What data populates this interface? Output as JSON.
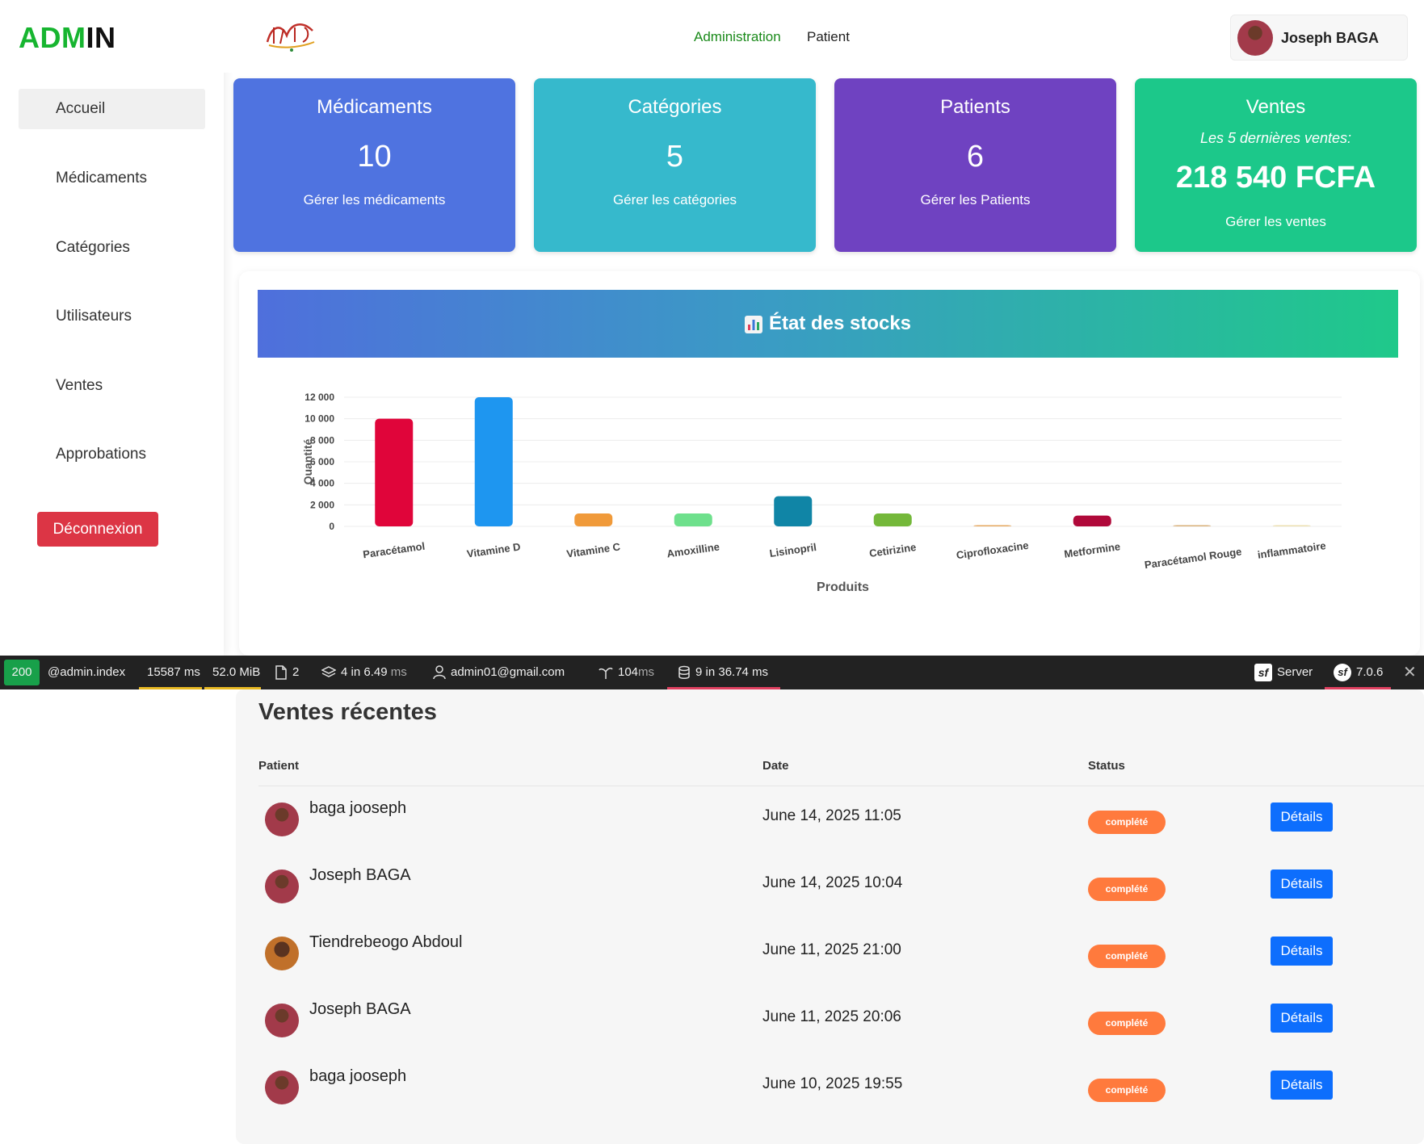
{
  "sidebar": {
    "brand_prefix": "ADM",
    "brand_suffix": "IN",
    "items": [
      {
        "label": "Accueil",
        "active": true
      },
      {
        "label": "Médicaments"
      },
      {
        "label": "Catégories"
      },
      {
        "label": "Utilisateurs"
      },
      {
        "label": "Ventes"
      },
      {
        "label": "Approbations"
      }
    ],
    "logout_label": "Déconnexion"
  },
  "header": {
    "nav": [
      {
        "label": "Administration",
        "active": true
      },
      {
        "label": "Patient"
      }
    ],
    "user_name": "Joseph BAGA"
  },
  "cards": [
    {
      "title": "Médicaments",
      "value": "10",
      "link": "Gérer les médicaments",
      "color": "#4f73e0"
    },
    {
      "title": "Catégories",
      "value": "5",
      "link": "Gérer les catégories",
      "color": "#36b9cc"
    },
    {
      "title": "Patients",
      "value": "6",
      "link": "Gérer les Patients",
      "color": "#6f42c1"
    },
    {
      "title": "Ventes",
      "subtitle": "Les 5 dernières ventes:",
      "value": "218 540 FCFA",
      "link": "Gérer les ventes",
      "color": "#1cc88a"
    }
  ],
  "chart_title": "État des stocks",
  "chart_data": {
    "type": "bar",
    "title": "État des stocks",
    "xlabel": "Produits",
    "ylabel": "Quantité",
    "ylim": [
      0,
      12000
    ],
    "yticks": [
      "0",
      "2 000",
      "4 000",
      "6 000",
      "8 000",
      "10 000",
      "12 000"
    ],
    "grid": true,
    "categories": [
      "Paracétamol",
      "Vitamine D",
      "Vitamine C",
      "Amoxilline",
      "Lisinopril",
      "Cetirizine",
      "Ciprofloxacine",
      "Metformine",
      "Paracétamol Rouge",
      "inflammatoire"
    ],
    "values": [
      10000,
      12000,
      1200,
      1200,
      2800,
      1200,
      0,
      1000,
      0,
      0
    ],
    "colors": [
      "#e0053a",
      "#1e96f0",
      "#f09a3a",
      "#6ee08c",
      "#1085a6",
      "#74b83a",
      "#e6a860",
      "#b0093a",
      "#d9b07a",
      "#ece0b0"
    ]
  },
  "toolbar": {
    "status": "200",
    "route": "@admin.index",
    "time": "15587 ms",
    "memory": "52.0 MiB",
    "files": "2",
    "events_count": "4",
    "events_time": "in 6.49",
    "events_unit": "ms",
    "user": "admin01@gmail.com",
    "twig_time": "104",
    "twig_unit": "ms",
    "db": "9 in 36.74 ms",
    "server": "Server",
    "version": "7.0.6"
  },
  "recent": {
    "title": "Ventes récentes",
    "columns": {
      "patient": "Patient",
      "date": "Date",
      "status": "Status"
    },
    "rows": [
      {
        "patient": "baga jooseph",
        "date": "June 14, 2025 11:05",
        "status": "complété",
        "action": "Détails"
      },
      {
        "patient": "Joseph BAGA",
        "date": "June 14, 2025 10:04",
        "status": "complété",
        "action": "Détails"
      },
      {
        "patient": "Tiendrebeogo Abdoul",
        "date": "June 11, 2025 21:00",
        "status": "complété",
        "action": "Détails"
      },
      {
        "patient": "Joseph BAGA",
        "date": "June 11, 2025 20:06",
        "status": "complété",
        "action": "Détails"
      },
      {
        "patient": "baga jooseph",
        "date": "June 10, 2025 19:55",
        "status": "complété",
        "action": "Détails"
      }
    ]
  }
}
